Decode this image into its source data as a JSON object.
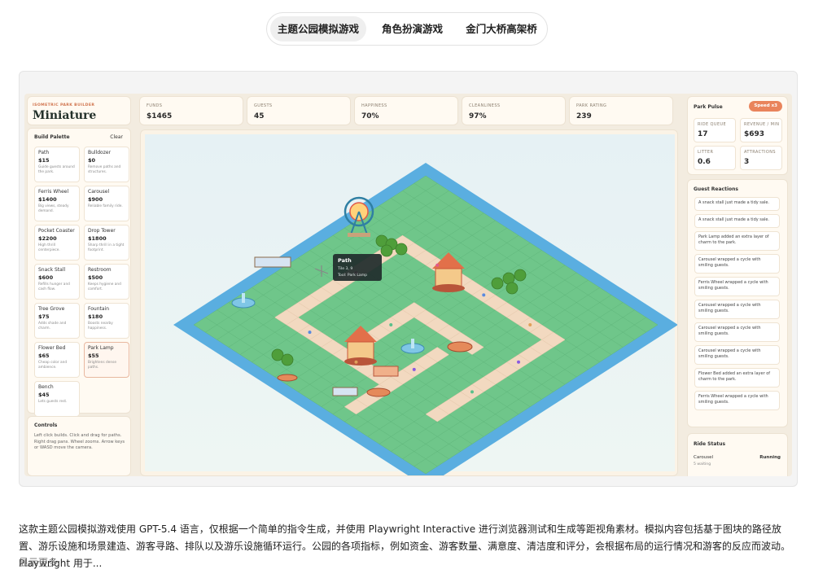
{
  "tabs": [
    {
      "label": "主题公园模拟游戏"
    },
    {
      "label": "角色扮演游戏"
    },
    {
      "label": "金门大桥高架桥"
    }
  ],
  "app": {
    "subtitle": "ISOMETRIC PARK BUILDER",
    "title": "Miniature",
    "palette_title": "Build Palette",
    "clear_label": "Clear",
    "palette": [
      {
        "name": "Path",
        "price": "$15",
        "desc": "Guide guests around the park."
      },
      {
        "name": "Bulldozer",
        "price": "$0",
        "desc": "Remove paths and structures."
      },
      {
        "name": "Ferris Wheel",
        "price": "$1400",
        "desc": "Big views, steady demand."
      },
      {
        "name": "Carousel",
        "price": "$900",
        "desc": "Reliable family ride."
      },
      {
        "name": "Pocket Coaster",
        "price": "$2200",
        "desc": "High thrill centerpiece."
      },
      {
        "name": "Drop Tower",
        "price": "$1800",
        "desc": "Sharp thrill in a tight footprint."
      },
      {
        "name": "Snack Stall",
        "price": "$600",
        "desc": "Refills hunger and cash flow."
      },
      {
        "name": "Restroom",
        "price": "$500",
        "desc": "Keeps hygiene and comfort."
      },
      {
        "name": "Tree Grove",
        "price": "$75",
        "desc": "Adds shade and charm."
      },
      {
        "name": "Fountain",
        "price": "$180",
        "desc": "Boosts nearby happiness."
      },
      {
        "name": "Flower Bed",
        "price": "$65",
        "desc": "Cheap color and ambience."
      },
      {
        "name": "Park Lamp",
        "price": "$55",
        "desc": "Brightens dense paths."
      },
      {
        "name": "Bench",
        "price": "$45",
        "desc": "Lets guests rest."
      }
    ],
    "controls_title": "Controls",
    "controls_text": "Left click builds. Click and drag for paths. Right drag pans. Wheel zooms. Arrow keys or WASD move the camera.",
    "stats": [
      {
        "label": "FUNDS",
        "value": "$1465"
      },
      {
        "label": "GUESTS",
        "value": "45"
      },
      {
        "label": "HAPPINESS",
        "value": "70%"
      },
      {
        "label": "CLEANLINESS",
        "value": "97%"
      },
      {
        "label": "PARK RATING",
        "value": "239"
      }
    ],
    "tooltip": {
      "title": "Path",
      "line1": "Tile 3, 9",
      "line2": "Tool: Park Lamp"
    },
    "pulse_title": "Park Pulse",
    "speed_label": "Speed x3",
    "pulse": [
      {
        "label": "RIDE QUEUE",
        "value": "17"
      },
      {
        "label": "REVENUE / MIN",
        "value": "$693"
      },
      {
        "label": "LITTER",
        "value": "0.6"
      },
      {
        "label": "ATTRACTIONS",
        "value": "3"
      }
    ],
    "reactions_title": "Guest Reactions",
    "reactions": [
      "A snack stall just made a tidy sale.",
      "A snack stall just made a tidy sale.",
      "Park Lamp added an extra layer of charm to the park.",
      "Carousel wrapped a cycle with smiling guests.",
      "Ferris Wheel wrapped a cycle with smiling guests.",
      "Carousel wrapped a cycle with smiling guests.",
      "Carousel wrapped a cycle with smiling guests.",
      "Carousel wrapped a cycle with smiling guests.",
      "Flower Bed added an extra layer of charm to the park.",
      "Ferris Wheel wrapped a cycle with smiling guests."
    ],
    "ride_status_title": "Ride Status",
    "ride": {
      "name": "Carousel",
      "status": "Running",
      "detail": "5 waiting"
    }
  },
  "caption": "这款主题公园模拟游戏使用 GPT-5.4 语言，仅根据一个简单的指令生成，并使用 Playwright Interactive 进行浏览器测试和生成等距视角素材。模拟内容包括基于图块的路径放置、游乐设施和场景建造、游客寻路、排队以及游乐设施循环运行。公园的各项指标，例如资金、游客数量、满意度、清洁度和评分，会根据布局的运行情况和游客的反应而波动。Playwright 用于...",
  "show_more": "显示更多",
  "colors": {
    "grass": "#6fc68a",
    "water": "#5aaee0",
    "path": "#f2d9c0",
    "accent": "#e9845c",
    "panel": "#fffaf2"
  }
}
